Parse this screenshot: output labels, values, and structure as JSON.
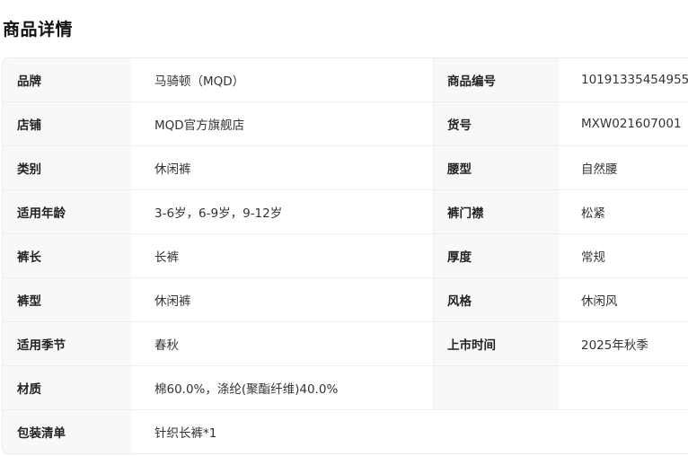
{
  "title": "商品详情",
  "rows": [
    {
      "l1": "品牌",
      "v1": "马骑顿（MQD）",
      "l2": "商品编号",
      "v2": "10191335454955"
    },
    {
      "l1": "店铺",
      "v1": "MQD官方旗舰店",
      "l2": "货号",
      "v2": "MXW021607001"
    },
    {
      "l1": "类别",
      "v1": "休闲裤",
      "l2": "腰型",
      "v2": "自然腰"
    },
    {
      "l1": "适用年龄",
      "v1": "3-6岁，6-9岁，9-12岁",
      "l2": "裤门襟",
      "v2": "松紧"
    },
    {
      "l1": "裤长",
      "v1": "长裤",
      "l2": "厚度",
      "v2": "常规"
    },
    {
      "l1": "裤型",
      "v1": "休闲裤",
      "l2": "风格",
      "v2": "休闲风"
    },
    {
      "l1": "适用季节",
      "v1": "春秋",
      "l2": "上市时间",
      "v2": "2025年秋季"
    },
    {
      "l1": "材质",
      "v1": "棉60.0%，涤纶(聚酯纤维)40.0%"
    },
    {
      "l1": "包装清单",
      "v1": "针织长裤*1"
    }
  ]
}
